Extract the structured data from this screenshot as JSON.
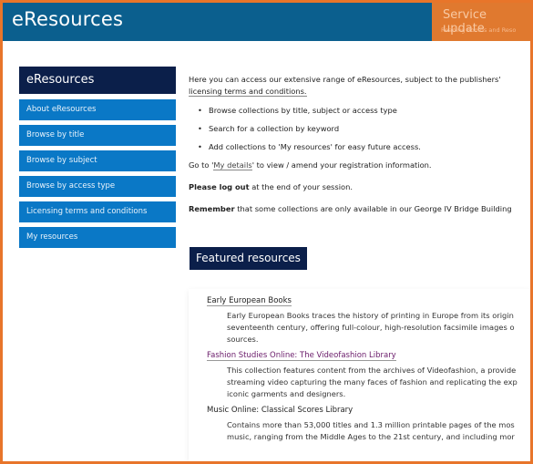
{
  "header": {
    "title": "eResources",
    "service_title": "Service update",
    "service_subtitle": "Reading Rooms and Reso"
  },
  "sidebar": {
    "title": "eResources",
    "items": [
      {
        "label": "About eResources"
      },
      {
        "label": "Browse by title"
      },
      {
        "label": "Browse by subject"
      },
      {
        "label": "Browse by access type"
      },
      {
        "label": "Licensing terms and conditions"
      },
      {
        "label": "My resources"
      }
    ]
  },
  "main": {
    "intro_text": "Here you can access our extensive range of eResources, subject to the publishers'",
    "intro_link": "licensing terms and conditions.",
    "bullets": [
      "Browse collections by title, subject or access type",
      "Search for a collection by keyword",
      "Add collections to 'My resources' for easy future access."
    ],
    "details_pre": "Go to '",
    "details_link": "My details",
    "details_post": "' to view / amend your registration information.",
    "logout_bold": "Please log out",
    "logout_rest": " at the end of your session.",
    "remember_bold": "Remember",
    "remember_rest": " that some collections are only available in our George IV Bridge Building",
    "featured_heading": "Featured resources",
    "resources": [
      {
        "title": "Early European Books",
        "desc": [
          "Early European Books traces the history of printing in Europe from its origin",
          "seventeenth century, offering full-colour, high-resolution facsimile images o",
          "sources."
        ]
      },
      {
        "title": "Fashion Studies Online: The Videofashion Library",
        "desc": [
          "This collection features content from the archives of Videofashion, a provide",
          "streaming video capturing the many faces of fashion and replicating the exp",
          "iconic garments and designers."
        ]
      },
      {
        "title": "Music Online: Classical Scores Library",
        "desc": [
          "Contains more than 53,000 titles and 1.3 million printable pages of the mos",
          "music, ranging from the Middle Ages to the 21st century, and including mor"
        ]
      }
    ]
  },
  "colors": {
    "header_bg": "#0b5f8e",
    "service_bg": "#e0792f",
    "sidebar_title_bg": "#0b1f4a",
    "sidebar_item_bg": "#0a78c6",
    "frame_border": "#e8752a"
  }
}
